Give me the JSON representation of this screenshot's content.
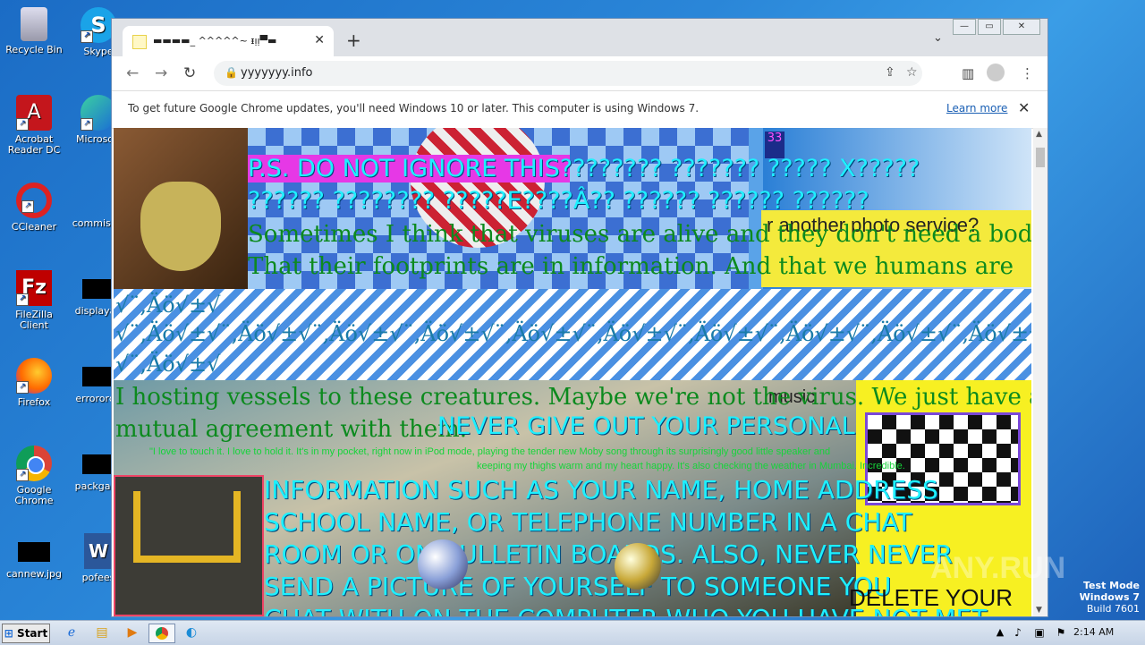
{
  "desktop": {
    "icons": [
      {
        "label": "Recycle Bin"
      },
      {
        "label": "Skype"
      },
      {
        "label": "Acrobat Reader DC"
      },
      {
        "label": "Microsoft"
      },
      {
        "label": "CCleaner"
      },
      {
        "label": "commissio"
      },
      {
        "label": "FileZilla Client"
      },
      {
        "label": "displayau"
      },
      {
        "label": "Firefox"
      },
      {
        "label": "errororde"
      },
      {
        "label": "Google Chrome"
      },
      {
        "label": "packgalle"
      },
      {
        "label": "cannew.jpg"
      },
      {
        "label": "pofees"
      }
    ]
  },
  "browser": {
    "tab_title": "▬▬▬▬_ ^^^^^~ ᵻᴉᴉ▀▬",
    "url": "yyyyyyy.info",
    "infobar": {
      "message": "To get future Google Chrome updates, you'll need Windows 10 or later. This computer is using Windows 7.",
      "link": "Learn more"
    }
  },
  "page": {
    "line1": "P.S. DO NOT IGNORE THIS???????? ??????? ????? X?????",
    "line2": "?????? ???????? ?????E????Â?? ?????? ?????? ??????",
    "para1a": "Sometimes I think that viruses are alive and they don't need a body.",
    "para1b": "That their footprints are in information. And that we humans are",
    "symbols1": "√¨‚Äö√±√",
    "symbols2": "√¨‚Äö√±√¨‚Äö√±√¨‚Äö√±√¨‚Äö√±√¨‚Äö√±√¨‚Äö√±√¨‚Äö√±√¨‚Äö√±√¨‚Äö√±√¨‚Äö√±√",
    "symbols3": "√¨‚Äö√±√",
    "photo_service": "r another photo service?",
    "para2a": "I hosting vessels to these creatures. Maybe we're not the virus. We just have a",
    "para2b": "mutual agreement with them.",
    "music": "music",
    "never1": "NEVER GIVE OUT YOUR PERSONAL",
    "small1": "\"I love to touch it. I love to hold it. It's in my pocket, right now in iPod mode, playing the tender new Moby song through its surprisingly good little speaker and",
    "small2": "keeping my thighs warm and my heart happy. It's also checking the weather in Mumbai. Incredible.",
    "info1": "INFORMATION SUCH AS YOUR NAME, HOME ADDRESS",
    "info2": "SCHOOL NAME, OR TELEPHONE NUMBER IN A CHAT",
    "info3": "ROOM OR ON BULLETIN BOARDS. ALSO, NEVER NEVER",
    "info4": "SEND A PICTURE OF YOURSELF TO SOMEONE YOU",
    "info5": "CHAT WITH ON THE COMPUTER WHO YOU HAVE NOT MET",
    "delete": "DELETE YOUR",
    "badge": "33"
  },
  "taskbar": {
    "start": "Start",
    "time": "2:14 AM"
  },
  "watermark": {
    "l1": "Test Mode",
    "l2": "Windows 7",
    "l3": "Build 7601",
    "brand": "ANY.RUN"
  }
}
